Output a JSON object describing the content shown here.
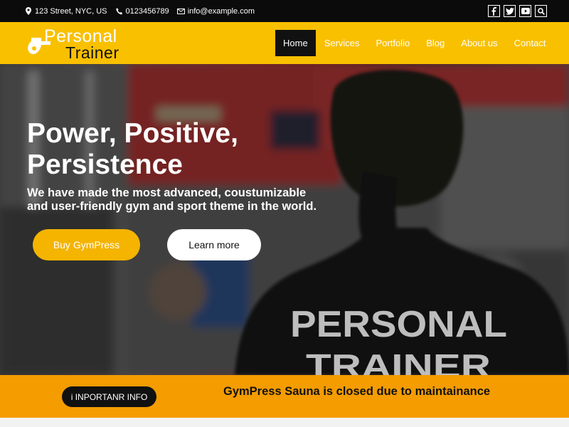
{
  "topbar": {
    "address": "123 Street, NYC, US",
    "phone": "0123456789",
    "email": "info@example.com",
    "social_icons": [
      "facebook-icon",
      "twitter-icon",
      "youtube-icon",
      "search-icon"
    ]
  },
  "logo": {
    "word1": "Personal",
    "word2": "Trainer"
  },
  "nav": {
    "items": [
      "Home",
      "Services",
      "Portfolio",
      "Blog",
      "About us",
      "Contact"
    ],
    "active": "Home"
  },
  "hero": {
    "headline": "Power, Positive, Persistence",
    "subheadline": "We have made the most advanced, coustumizable and user-friendly gym and sport theme in the world.",
    "buy_label": "Buy GymPress",
    "learn_label": "Learn more",
    "shirt_text_line1": "PERSONAL",
    "shirt_text_line2": "TRAINER"
  },
  "infobar": {
    "pill_label": "i INPORTANR INFO",
    "message": "GymPress Sauna is closed due to maintainance"
  },
  "colors": {
    "accent_yellow": "#f9c000",
    "button_yellow": "#f4b400",
    "info_orange": "#f49c00",
    "dark": "#111111"
  }
}
